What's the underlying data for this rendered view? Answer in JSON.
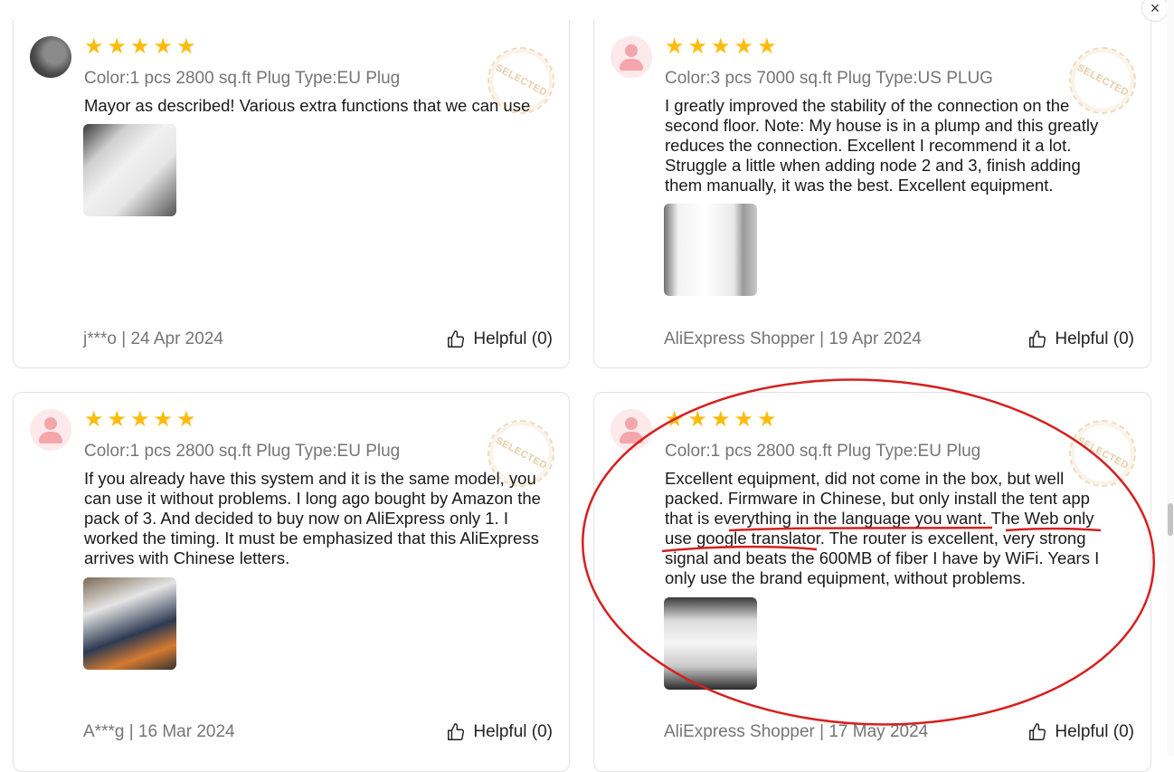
{
  "close_icon_label": "×",
  "seal_text": "SELECTED",
  "star_glyph": "★",
  "helpful_label": "Helpful (0)",
  "reviews": [
    {
      "rating": 5,
      "variant": "Color:1 pcs 2800 sq.ft Plug Type:EU Plug",
      "text": "Mayor as described! Various extra functions that we can use",
      "meta": "j***o | 24 Apr 2024"
    },
    {
      "rating": 5,
      "variant": "Color:3 pcs 7000 sq.ft Plug Type:US PLUG",
      "text": "I greatly improved the stability of the connection on the second floor. Note: My house is in a plump and this greatly reduces the connection. Excellent I recommend it a lot. Struggle a little when adding node 2 and 3, finish adding them manually, it was the best. Excellent equipment.",
      "meta": "AliExpress Shopper | 19 Apr 2024"
    },
    {
      "rating": 5,
      "variant": "Color:1 pcs 2800 sq.ft Plug Type:EU Plug",
      "text": "If you already have this system and it is the same model, you can use it without problems. I long ago bought by Amazon the pack of 3. And decided to buy now on AliExpress only 1. I worked the timing. It must be emphasized that this AliExpress arrives with Chinese letters.",
      "meta": "A***g | 16 Mar 2024"
    },
    {
      "rating": 5,
      "variant": "Color:1 pcs 2800 sq.ft Plug Type:EU Plug",
      "text": "Excellent equipment, did not come in the box, but well packed. Firmware in Chinese, but only install the tent app that is everything in the language you want. The Web only use google translator. The router is excellent, very strong signal and beats the 600MB of fiber I have by WiFi. Years I only use the brand equipment, without problems.",
      "meta": "AliExpress Shopper | 17 May 2024"
    }
  ],
  "colors": {
    "star": "#fdbb0d",
    "annotation": "#d62020",
    "muted_text": "#757575"
  }
}
